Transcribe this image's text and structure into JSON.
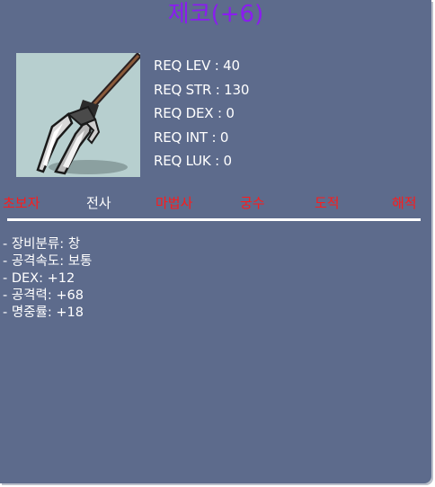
{
  "item": {
    "name": "제코(+6)",
    "icon": "spear-icon",
    "colors": {
      "name": "#8a1cf0",
      "panel": "#5d6b8c",
      "icon_bg": "#b7cfcf",
      "unavailable": "#ff1a1a",
      "available": "#ffffff"
    }
  },
  "requirements": [
    "REQ LEV : 40",
    "REQ STR : 130",
    "REQ DEX : 0",
    "REQ INT : 0",
    "REQ LUK : 0"
  ],
  "jobs": [
    {
      "label": "초보자",
      "available": false
    },
    {
      "label": "전사",
      "available": true
    },
    {
      "label": "마법사",
      "available": false
    },
    {
      "label": "궁수",
      "available": false
    },
    {
      "label": "도적",
      "available": false
    },
    {
      "label": "해적",
      "available": false
    }
  ],
  "stats": [
    "- 장비분류: 창",
    "- 공격속도: 보통",
    "- DEX: +12",
    "- 공격력: +68",
    "- 명중률: +18"
  ]
}
